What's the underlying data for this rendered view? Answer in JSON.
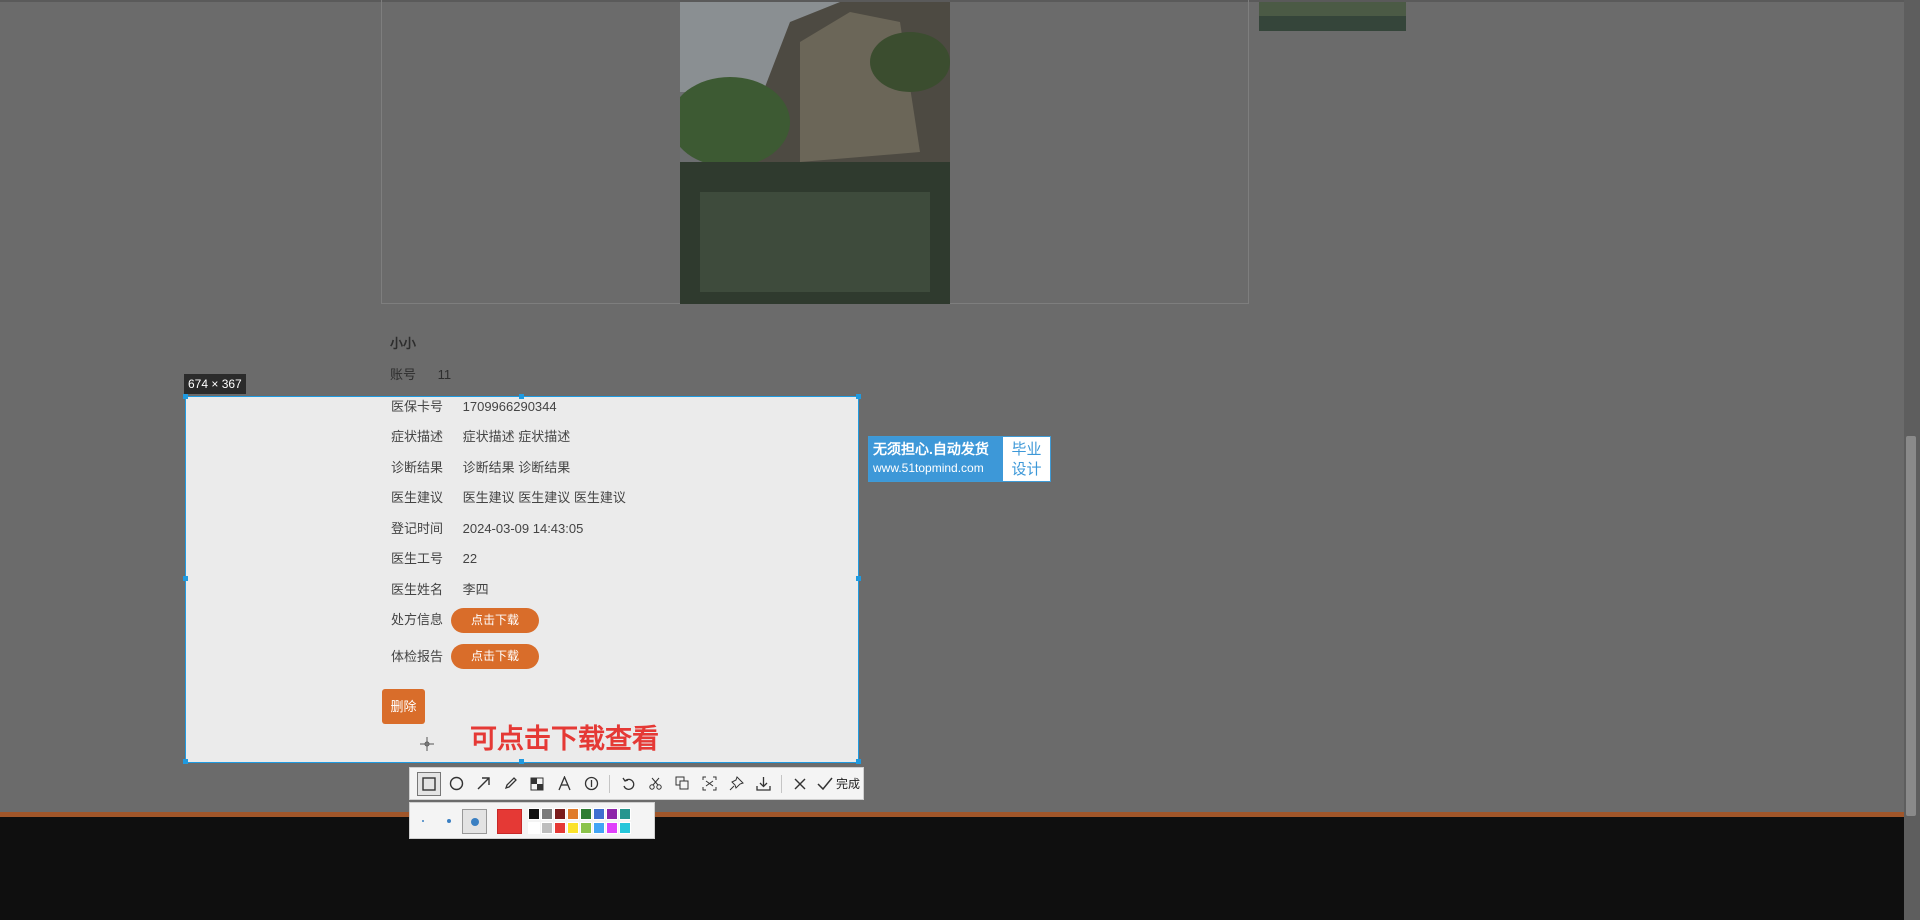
{
  "record": {
    "name": "小小",
    "fields": [
      {
        "label": "账号",
        "value": "11"
      },
      {
        "label": "医保卡号",
        "value": "1709966290344"
      },
      {
        "label": "症状描述",
        "value": "症状描述 症状描述"
      },
      {
        "label": "诊断结果",
        "value": "诊断结果 诊断结果"
      },
      {
        "label": "医生建议",
        "value": "医生建议 医生建议 医生建议"
      },
      {
        "label": "登记时间",
        "value": "2024-03-09 14:43:05"
      },
      {
        "label": "医生工号",
        "value": "22"
      },
      {
        "label": "医生姓名",
        "value": "李四"
      }
    ],
    "prescription_label": "处方信息",
    "exam_label": "体检报告",
    "download_button": "点击下载",
    "delete_button": "删除"
  },
  "ad": {
    "line1": "无须担心.自动发货",
    "line2": "www.51topmind.com",
    "right1": "毕业",
    "right2": "设计"
  },
  "screenshot_tool": {
    "size_label": "674 × 367",
    "annotation_text": "可点击下载查看",
    "done_label": "完成",
    "tools": [
      "rectangle-icon",
      "ellipse-icon",
      "arrow-icon",
      "pencil-icon",
      "mosaic-icon",
      "text-icon",
      "number-icon",
      "undo-icon",
      "scissors-icon",
      "copy-icon",
      "ocr-icon",
      "pin-icon",
      "download-icon",
      "close-icon",
      "check-icon"
    ],
    "current_color": "#e53935",
    "swatches_top": [
      "#111111",
      "#7a7a7a",
      "#7b1c1c",
      "#e07b2a",
      "#2e7d32",
      "#3f6fd0",
      "#8e24aa",
      "#26968f"
    ],
    "swatches_bottom": [
      "#ffffff",
      "#bdbdbd",
      "#e53935",
      "#fbe22b",
      "#8bc34a",
      "#42a5f5",
      "#e040fb",
      "#26c6da"
    ]
  }
}
